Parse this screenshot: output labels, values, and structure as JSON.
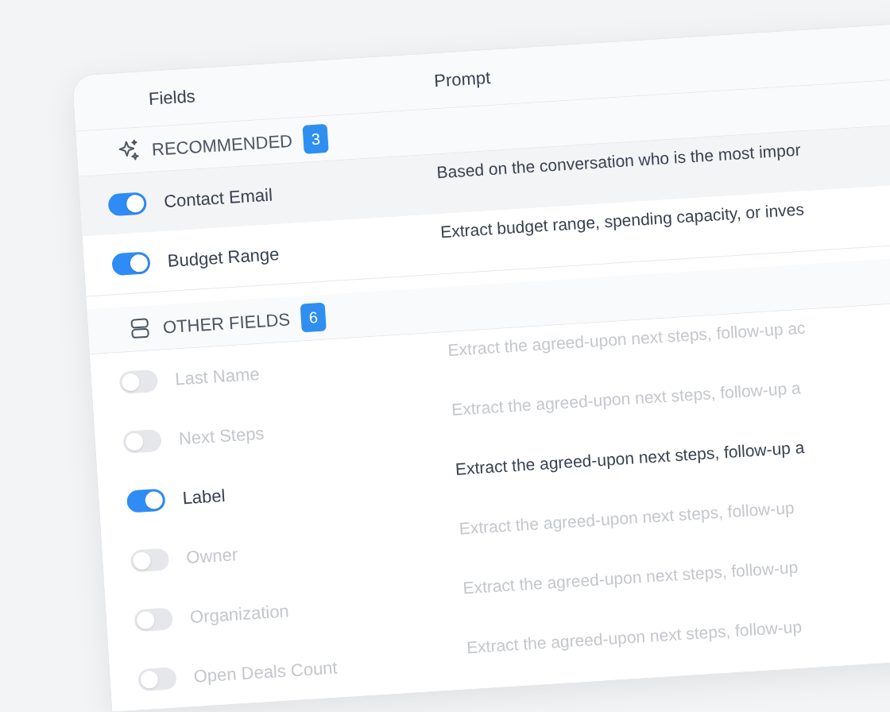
{
  "header": {
    "fields": "Fields",
    "prompt": "Prompt"
  },
  "sections": [
    {
      "kind": "recommended",
      "title": "RECOMMENDED",
      "count": "3",
      "fields": [
        {
          "name": "Contact Email",
          "prompt": "Based on the conversation who is the most impor",
          "on": true,
          "selected": true
        },
        {
          "name": "Budget Range",
          "prompt": "Extract budget range, spending capacity, or inves",
          "on": true,
          "selected": false
        }
      ]
    },
    {
      "kind": "other",
      "title": "OTHER FIELDS",
      "count": "6",
      "fields": [
        {
          "name": "Last Name",
          "prompt": "Extract the agreed-upon next steps, follow-up ac",
          "on": false,
          "selected": false
        },
        {
          "name": "Next Steps",
          "prompt": "Extract the agreed-upon next steps, follow-up a",
          "on": false,
          "selected": false
        },
        {
          "name": "Label",
          "prompt": "Extract the agreed-upon next steps, follow-up a",
          "on": true,
          "selected": false
        },
        {
          "name": "Owner",
          "prompt": "Extract the agreed-upon next steps, follow-up",
          "on": false,
          "selected": false
        },
        {
          "name": "Organization",
          "prompt": "Extract the agreed-upon next steps, follow-up",
          "on": false,
          "selected": false
        },
        {
          "name": "Open Deals Count",
          "prompt": "Extract the agreed-upon next steps, follow-up",
          "on": false,
          "selected": false
        }
      ]
    }
  ]
}
